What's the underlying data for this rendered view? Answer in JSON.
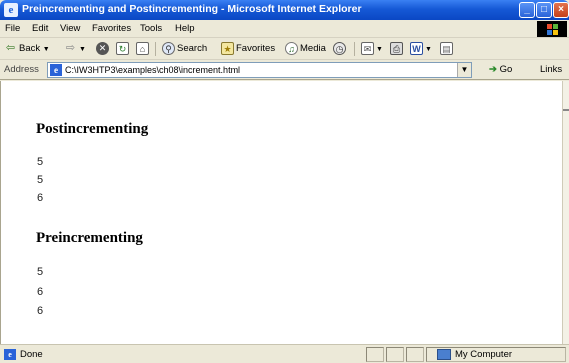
{
  "window": {
    "title": "Preincrementing and Postincrementing - Microsoft Internet Explorer",
    "app_icon": "e"
  },
  "titlebar_buttons": {
    "minimize": "_",
    "maximize": "□",
    "close": "×"
  },
  "menu": {
    "items": [
      "File",
      "Edit",
      "View",
      "Favorites",
      "Tools",
      "Help"
    ]
  },
  "toolbar": {
    "back": "Back",
    "search": "Search",
    "favorites": "Favorites",
    "media": "Media"
  },
  "addressbar": {
    "label": "Address",
    "url": "C:\\IW3HTP3\\examples\\ch08\\increment.html",
    "go": "Go",
    "links": "Links"
  },
  "page": {
    "sections": [
      {
        "heading": "Postincrementing",
        "values": [
          "5",
          "5",
          "6"
        ]
      },
      {
        "heading": "Preincrementing",
        "values": [
          "5",
          "6",
          "6"
        ]
      }
    ]
  },
  "statusbar": {
    "status": "Done",
    "zone": "My Computer"
  },
  "colors": {
    "titlebar": "#0b47c4",
    "chrome": "#ece9d8"
  }
}
